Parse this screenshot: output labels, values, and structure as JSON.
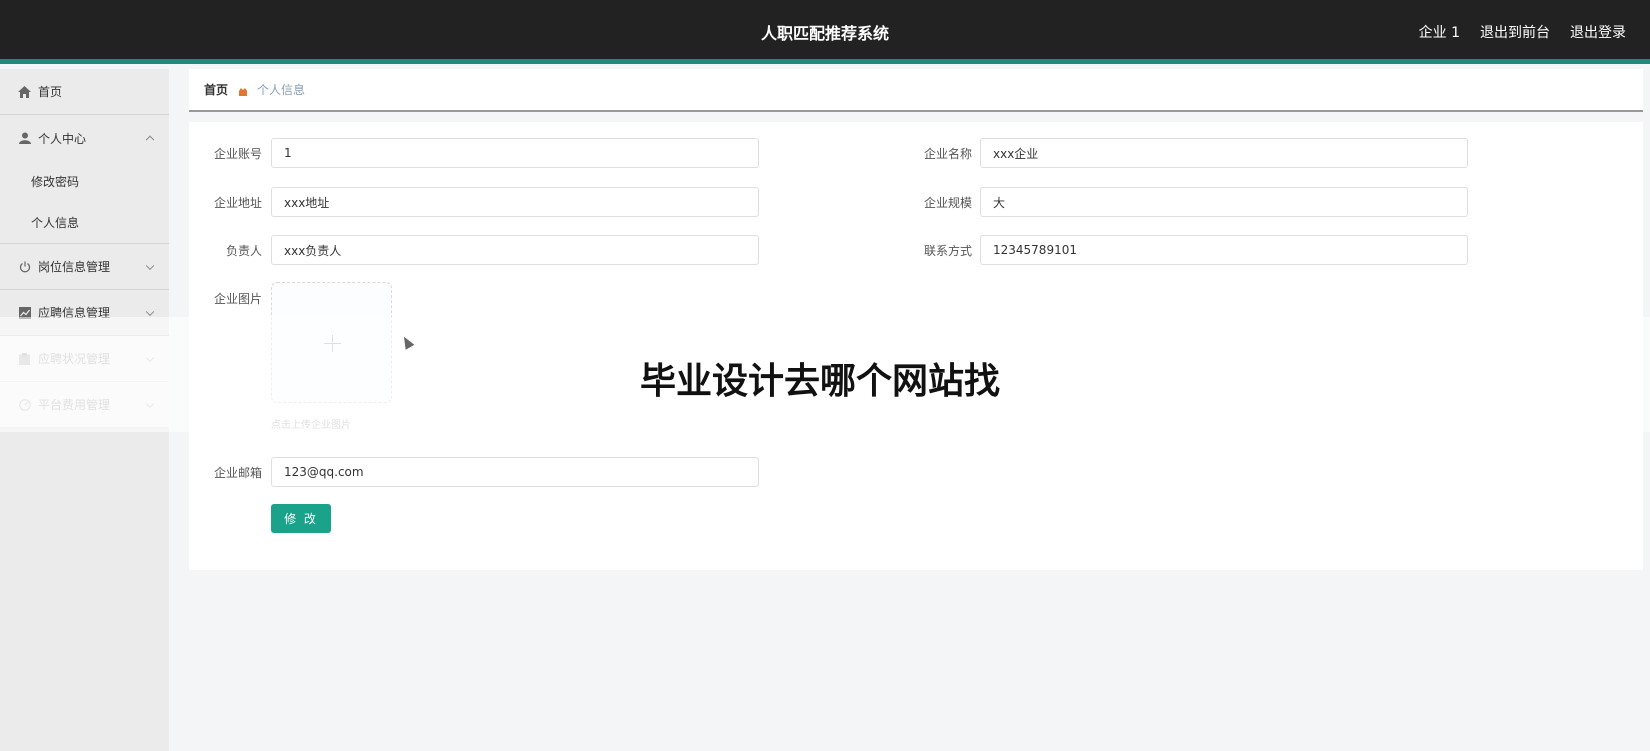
{
  "header": {
    "title": "人职匹配推荐系统",
    "user": "企业 1",
    "to_front": "退出到前台",
    "logout": "退出登录"
  },
  "sidebar": {
    "home": "首页",
    "personal_center": "个人中心",
    "change_password": "修改密码",
    "personal_info": "个人信息",
    "job_info": "岗位信息管理",
    "application_info": "应聘信息管理",
    "application_status": "应聘状况管理",
    "platform_fee": "平台费用管理"
  },
  "breadcrumb": {
    "home": "首页",
    "current": "个人信息"
  },
  "form": {
    "account_label": "企业账号",
    "account_value": "1",
    "name_label": "企业名称",
    "name_value": "xxx企业",
    "address_label": "企业地址",
    "address_value": "xxx地址",
    "scale_label": "企业规模",
    "scale_value": "大",
    "manager_label": "负责人",
    "manager_value": "xxx负责人",
    "contact_label": "联系方式",
    "contact_value": "12345789101",
    "image_label": "企业图片",
    "image_hint": "点击上传企业图片",
    "email_label": "企业邮箱",
    "email_value": "123@qq.com",
    "submit": "修 改"
  },
  "overlay_text": "毕业设计去哪个网站找",
  "colors": {
    "header_bg": "#222222",
    "accent": "#1d8a7e",
    "button": "#1aa38a"
  }
}
